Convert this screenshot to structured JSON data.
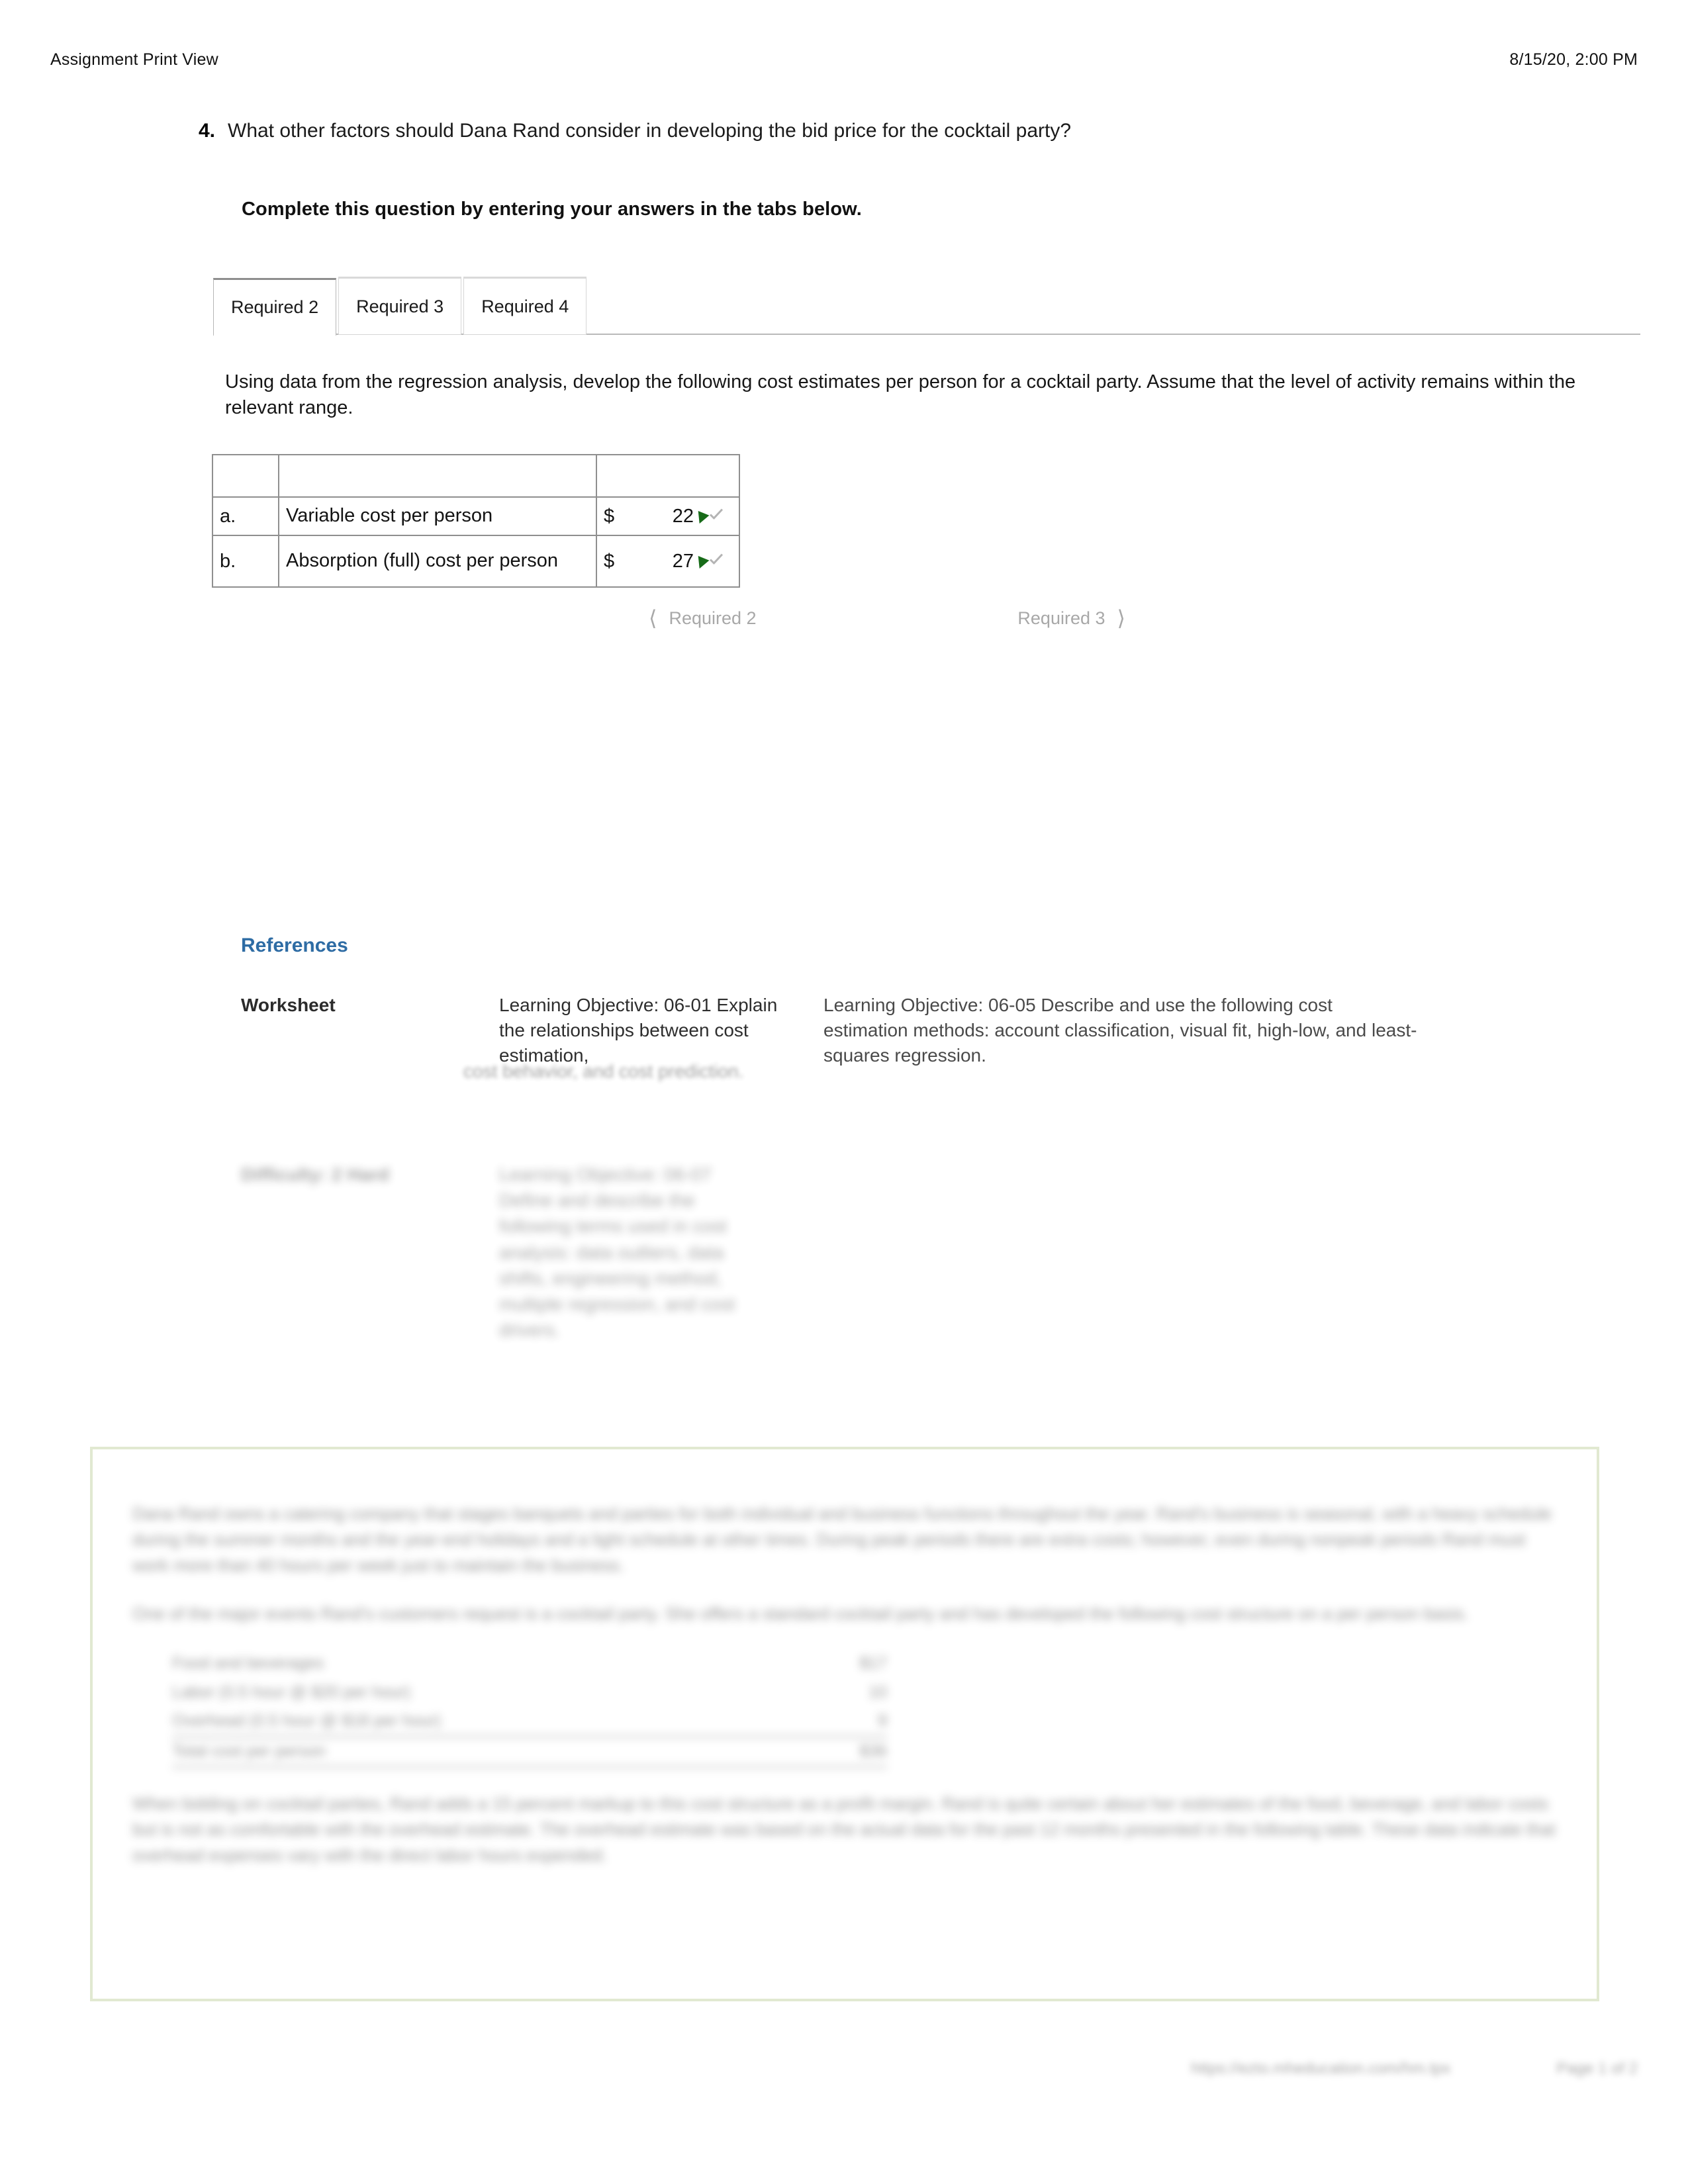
{
  "header": {
    "title": "Assignment Print View",
    "timestamp": "8/15/20, 2:00 PM"
  },
  "question": {
    "number": "4.",
    "text": "What other factors should Dana Rand consider in developing the bid price for the cocktail party?",
    "instruction": "Complete this question by entering your answers in the tabs below."
  },
  "tabs": {
    "items": [
      {
        "label": "Required 2",
        "active": true
      },
      {
        "label": "Required 3",
        "active": false
      },
      {
        "label": "Required 4",
        "active": false
      }
    ]
  },
  "panel": {
    "prompt": "Using data from the regression analysis, develop the following cost estimates per person for a cocktail party. Assume that the level of activity remains within the relevant range.",
    "table": {
      "rows": [
        {
          "label": "a.",
          "description": "Variable cost per person",
          "currency": "$",
          "value": "22",
          "status": "correct"
        },
        {
          "label": "b.",
          "description": "Absorption (full) cost per person",
          "currency": "$",
          "value": "27",
          "status": "correct"
        }
      ]
    },
    "nav": {
      "prev_label": "Required 2",
      "prev_icon": "chevron-left",
      "next_label": "Required 3",
      "next_icon": "chevron-right"
    }
  },
  "references": {
    "title": "References",
    "rows": [
      {
        "label": "Worksheet",
        "objective_a": "Learning Objective: 06-01 Explain the relationships between cost estimation,",
        "objective_a_fade": "cost behavior, and cost prediction.",
        "objective_b": "Learning Objective: 06-05 Describe and use the following cost estimation methods: account classification, visual fit, high-low, and least-squares regression."
      },
      {
        "label": "Difficulty: 2 Hard",
        "objective_a": "Learning Objective: 06-07 Define and describe the following terms used in cost analysis: data outliers, data shifts, engineering method, multiple regression, and cost drivers.",
        "objective_b": ""
      }
    ]
  },
  "problem_box": {
    "paragraphs": [
      "Dana Rand owns a catering company that stages banquets and parties for both individual and business functions throughout the year. Rand's business is seasonal, with a heavy schedule during the summer months and the year-end holidays and a light schedule at other times. During peak periods there are extra costs; however, even during nonpeak periods Rand must work more than 40 hours per week just to maintain the business.",
      "One of the major events Rand's customers request is a cocktail party. She offers a standard cocktail party and has developed the following cost structure on a per person basis."
    ],
    "cost_table": {
      "rows": [
        {
          "item": "Food and beverages",
          "amount": "$17"
        },
        {
          "item": "Labor (0.5 hour @ $20 per hour)",
          "amount": "10"
        },
        {
          "item": "Overhead (0.5 hour @ $18 per hour)",
          "amount": "9"
        },
        {
          "item": "Total cost per person",
          "amount": "$36",
          "total": true
        }
      ]
    },
    "closing_paragraph": "When bidding on cocktail parties, Rand adds a 15 percent markup to this cost structure as a profit margin. Rand is quite certain about her estimates of the food, beverage, and labor costs but is not as comfortable with the overhead estimate. The overhead estimate was based on the actual data for the past 12 months presented in the following table. These data indicate that overhead expenses vary with the direct labor hours expended."
  },
  "footer": {
    "left": "",
    "url": "https://ezto.mheducation.com/hm.tpx",
    "page": "Page 1 of 2"
  }
}
